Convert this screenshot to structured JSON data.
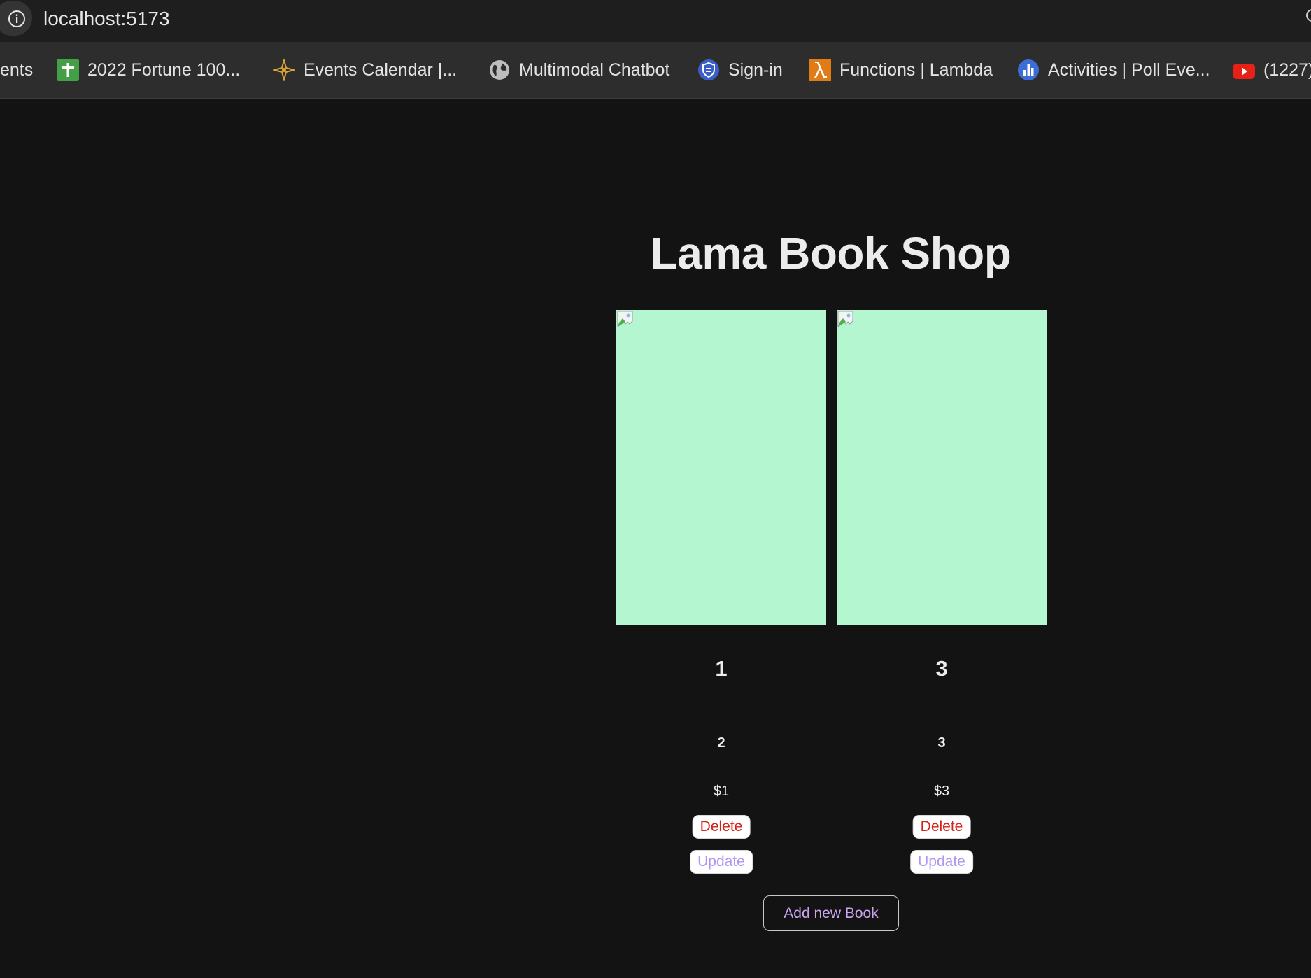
{
  "browser": {
    "url": "localhost:5173",
    "bookmarks": [
      {
        "label": "ents",
        "icon": "none"
      },
      {
        "label": "2022 Fortune 100...",
        "icon": "sheets-icon"
      },
      {
        "label": "Events Calendar |...",
        "icon": "compass-icon"
      },
      {
        "label": "Multimodal Chatbot",
        "icon": "globe-icon"
      },
      {
        "label": "Sign-in",
        "icon": "shield-icon"
      },
      {
        "label": "Functions | Lambda",
        "icon": "lambda-icon"
      },
      {
        "label": "Activities | Poll Eve...",
        "icon": "poll-icon"
      },
      {
        "label": "(1227)",
        "icon": "youtube-icon"
      }
    ]
  },
  "page": {
    "title": "Lama Book Shop",
    "books": [
      {
        "title": "1",
        "desc": "2",
        "price": "$1",
        "delete_label": "Delete",
        "update_label": "Update"
      },
      {
        "title": "3",
        "desc": "3",
        "price": "$3",
        "delete_label": "Delete",
        "update_label": "Update"
      }
    ],
    "add_label": "Add new Book"
  },
  "colors": {
    "background": "#131313",
    "cover": "#b4f6d0",
    "delete_text": "#d2221a",
    "update_text": "#b095f3",
    "add_text": "#c9a5f0"
  }
}
